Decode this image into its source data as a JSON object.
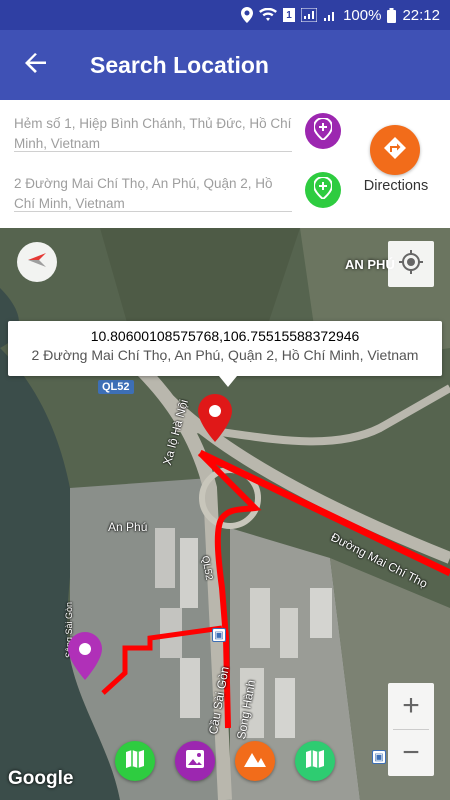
{
  "status_bar": {
    "sim_badge": "1",
    "battery": "100%",
    "time": "22:12"
  },
  "app_bar": {
    "title": "Search Location",
    "back_icon": "arrow-back-icon"
  },
  "search": {
    "origin_value": "Hẻm số 1, Hiệp Bình Chánh, Thủ Đức, Hồ Chí Minh, Vietnam",
    "destination_value": "2 Đường Mai Chí Thọ, An Phú, Quận 2, Hồ Chí Minh, Vietnam",
    "origin_pin_icon": "pin-add-icon",
    "destination_pin_icon": "pin-add-icon",
    "directions_label": "Directions",
    "directions_icon": "directions-icon",
    "colors": {
      "origin": "#9c27b0",
      "destination": "#2ecc40",
      "directions": "#f26c1a"
    }
  },
  "map": {
    "place_label_anphu": "AN PHÚ",
    "place_label_anphu_small": "An Phú",
    "road_label_xalo": "Xa lộ Hà Nội",
    "road_label_maichitho": "Đường Mai Chí Thọ",
    "road_label_cau": "Cầu Sài Gòn",
    "road_label_songhanh": "Song Hành",
    "river_label": "Sông Sài Gòn",
    "road_badge_ql52_a": "QL52",
    "road_badge_ql52_b": "QL52",
    "route_color": "#ff0000",
    "info_window": {
      "coords": "10.80600108575768,106.75515588372946",
      "address": "2 Đường Mai Chí Thọ, An Phú, Quận 2, Hồ Chí Minh, Vietnam"
    },
    "zoom_in": "+",
    "zoom_out": "−",
    "attribution": "Google"
  },
  "bottom_actions": [
    {
      "name": "map-type-normal",
      "icon": "map-icon",
      "color": "#2ecc40"
    },
    {
      "name": "map-type-satellite",
      "icon": "image-icon",
      "color": "#9c27b0"
    },
    {
      "name": "map-type-terrain",
      "icon": "terrain-icon",
      "color": "#f26c1a"
    },
    {
      "name": "map-type-hybrid",
      "icon": "map-icon",
      "color": "#2ecc71"
    }
  ]
}
